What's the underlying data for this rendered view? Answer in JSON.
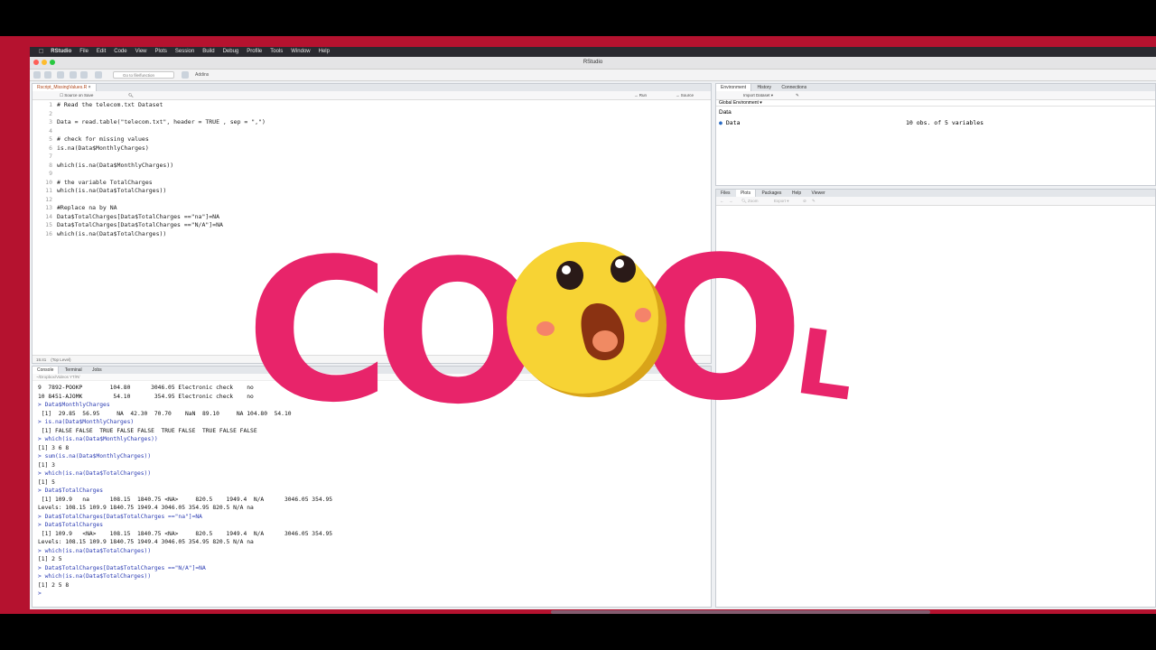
{
  "menubar": {
    "app": "RStudio",
    "items": [
      "File",
      "Edit",
      "Code",
      "View",
      "Plots",
      "Session",
      "Build",
      "Debug",
      "Profile",
      "Tools",
      "Window",
      "Help"
    ]
  },
  "window": {
    "title": "RStudio",
    "goto_placeholder": "Go to file/function",
    "addins_label": "Addins"
  },
  "editor": {
    "tab_label": "Rscript_MissingValues.R",
    "source_on_save": "Source on Save",
    "run_label": "Run",
    "source_label": "Source",
    "status_position": "15:41",
    "status_scope": "(Top Level)",
    "lines": [
      {
        "n": "1",
        "t": "# Read the telecom.txt Dataset",
        "k": "comment"
      },
      {
        "n": "2",
        "t": "",
        "k": "code"
      },
      {
        "n": "3",
        "t": "Data = read.table(\"telecom.txt\", header = TRUE , sep = \",\")",
        "k": "code"
      },
      {
        "n": "4",
        "t": "",
        "k": "code"
      },
      {
        "n": "5",
        "t": "# check for missing values",
        "k": "comment"
      },
      {
        "n": "6",
        "t": "is.na(Data$MonthlyCharges)",
        "k": "code"
      },
      {
        "n": "7",
        "t": "",
        "k": "code"
      },
      {
        "n": "8",
        "t": "which(is.na(Data$MonthlyCharges))",
        "k": "code"
      },
      {
        "n": "9",
        "t": "",
        "k": "code"
      },
      {
        "n": "10",
        "t": "# the variable TotalCharges",
        "k": "comment"
      },
      {
        "n": "11",
        "t": "which(is.na(Data$TotalCharges))",
        "k": "code"
      },
      {
        "n": "12",
        "t": "",
        "k": "code"
      },
      {
        "n": "13",
        "t": "#Replace na by NA",
        "k": "comment"
      },
      {
        "n": "14",
        "t": "Data$TotalCharges[Data$TotalCharges ==\"na\"]=NA",
        "k": "code"
      },
      {
        "n": "15",
        "t": "Data$TotalCharges[Data$TotalCharges ==\"N/A\"]=NA",
        "k": "code"
      },
      {
        "n": "16",
        "t": "which(is.na(Data$TotalCharges))",
        "k": "code"
      }
    ]
  },
  "console": {
    "tabs": [
      "Console",
      "Terminal",
      "Jobs"
    ],
    "path": "~/Dropbox/Videos YT/R/",
    "lines": [
      {
        "t": "9  7892-POOKP        104.80      3046.05 Electronic check    no",
        "k": "out"
      },
      {
        "t": "10 8451-AJOMK         54.10       354.95 Electronic check    no",
        "k": "out"
      },
      {
        "t": "> Data$MonthlyCharges",
        "k": "cmd"
      },
      {
        "t": " [1]  29.85  56.95     NA  42.30  70.70    NaN  89.10     NA 104.80  54.10",
        "k": "out"
      },
      {
        "t": "> is.na(Data$MonthlyCharges)",
        "k": "cmd"
      },
      {
        "t": " [1] FALSE FALSE  TRUE FALSE FALSE  TRUE FALSE  TRUE FALSE FALSE",
        "k": "out"
      },
      {
        "t": "> which(is.na(Data$MonthlyCharges))",
        "k": "cmd"
      },
      {
        "t": "[1] 3 6 8",
        "k": "out"
      },
      {
        "t": "> sum(is.na(Data$MonthlyCharges))",
        "k": "cmd"
      },
      {
        "t": "[1] 3",
        "k": "out"
      },
      {
        "t": "> which(is.na(Data$TotalCharges))",
        "k": "cmd"
      },
      {
        "t": "[1] 5",
        "k": "out"
      },
      {
        "t": "> Data$TotalCharges",
        "k": "cmd"
      },
      {
        "t": " [1] 109.9   na      108.15  1840.75 <NA>     820.5    1949.4  N/A      3046.05 354.95",
        "k": "out"
      },
      {
        "t": "Levels: 108.15 109.9 1840.75 1949.4 3046.05 354.95 820.5 N/A na",
        "k": "out"
      },
      {
        "t": "> Data$TotalCharges[Data$TotalCharges ==\"na\"]=NA",
        "k": "cmd"
      },
      {
        "t": "> Data$TotalCharges",
        "k": "cmd"
      },
      {
        "t": " [1] 109.9   <NA>    108.15  1840.75 <NA>     820.5    1949.4  N/A      3046.05 354.95",
        "k": "out"
      },
      {
        "t": "Levels: 108.15 109.9 1840.75 1949.4 3046.05 354.95 820.5 N/A na",
        "k": "out"
      },
      {
        "t": "> which(is.na(Data$TotalCharges))",
        "k": "cmd"
      },
      {
        "t": "[1] 2 5",
        "k": "out"
      },
      {
        "t": "> Data$TotalCharges[Data$TotalCharges ==\"N/A\"]=NA",
        "k": "cmd"
      },
      {
        "t": "> which(is.na(Data$TotalCharges))",
        "k": "cmd"
      },
      {
        "t": "[1] 2 5 8",
        "k": "out"
      },
      {
        "t": ">",
        "k": "cmd"
      }
    ]
  },
  "environment": {
    "tabs": [
      "Environment",
      "History",
      "Connections"
    ],
    "import_label": "Import Dataset",
    "scope_label": "Global Environment",
    "section": "Data",
    "var_name": "Data",
    "var_desc": "10 obs. of 5 variables"
  },
  "files": {
    "tabs": [
      "Files",
      "Plots",
      "Packages",
      "Help",
      "Viewer"
    ],
    "zoom_label": "Zoom",
    "export_label": "Export"
  },
  "overlay": {
    "text_c": "C",
    "text_o1": "O",
    "text_o2": "O",
    "text_l": "L"
  },
  "colors": {
    "overlay_pink": "#e8246a",
    "emoji_yellow": "#f7d334",
    "background_red": "#b5122f"
  }
}
